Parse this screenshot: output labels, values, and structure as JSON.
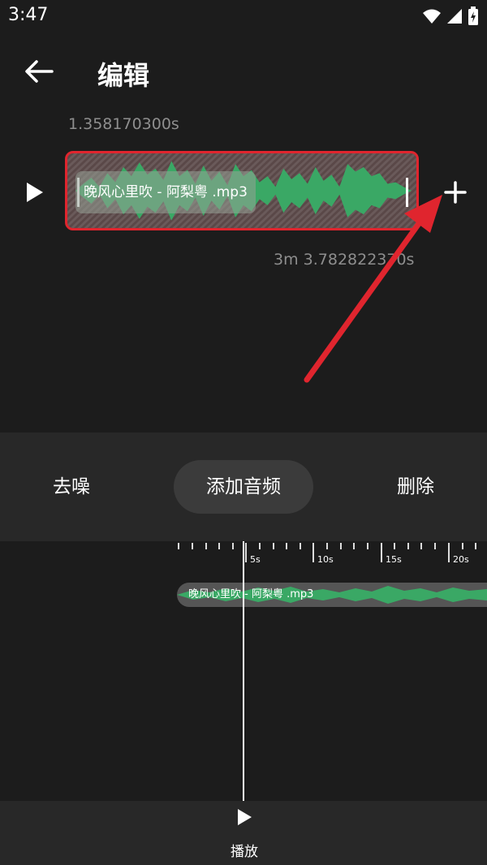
{
  "status_bar": {
    "time": "3:47"
  },
  "header": {
    "title": "编辑"
  },
  "clip": {
    "start_time": "1.358170300s",
    "end_time": "3m 3.782822370s",
    "filename": "晚风心里吹 - 阿梨粤 .mp3"
  },
  "actions": {
    "denoise": "去噪",
    "add_audio": "添加音频",
    "delete": "删除"
  },
  "timeline": {
    "ticks": [
      "5s",
      "10s",
      "15s",
      "20s"
    ],
    "track_label": "晚风心里吹 - 阿梨粤 .mp3"
  },
  "bottom": {
    "play_label": "播放"
  },
  "colors": {
    "accent_green": "#3aa865",
    "highlight_red": "#e0252e"
  }
}
